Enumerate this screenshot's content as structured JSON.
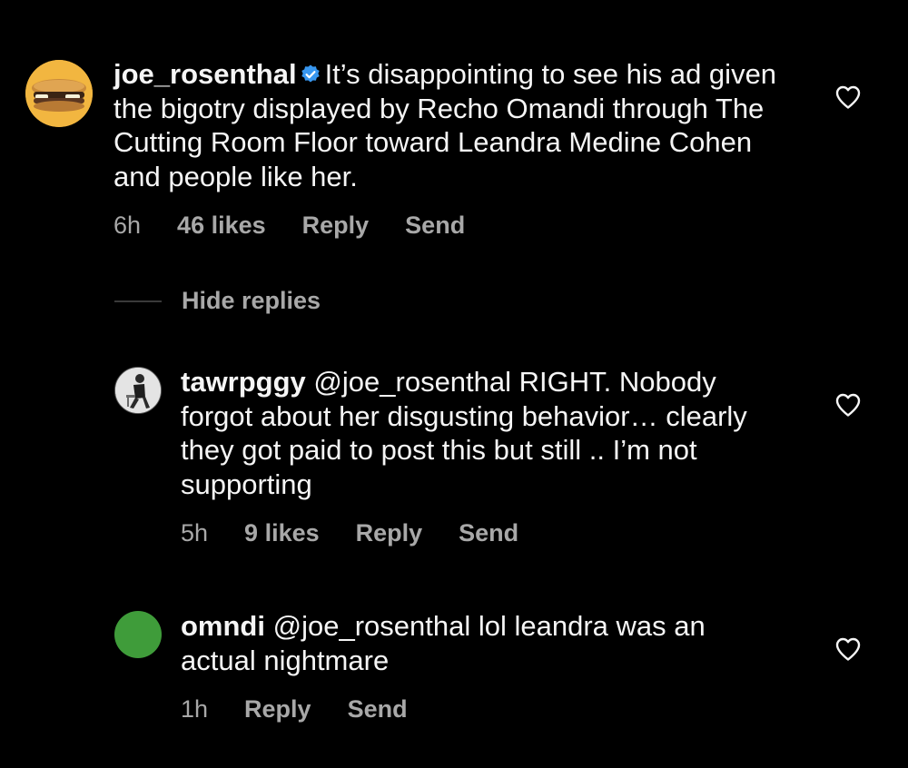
{
  "comments": [
    {
      "username": "joe_rosenthal",
      "verified": true,
      "text": "It’s disappointing to see his ad given the bigotry displayed by Recho Omandi through The Cutting Room Floor toward Leandra Medine Cohen and people like her.",
      "time": "6h",
      "likes": "46 likes",
      "reply_label": "Reply",
      "send_label": "Send",
      "avatar_icon": "sandwich-avatar"
    }
  ],
  "hide_replies_label": "Hide replies",
  "replies": [
    {
      "username": "tawrpggy",
      "mention": "@joe_rosenthal",
      "text": "RIGHT. Nobody forgot about her disgusting behavior… clearly they got paid to post this but still .. I’m not supporting",
      "time": "5h",
      "likes": "9 likes",
      "reply_label": "Reply",
      "send_label": "Send",
      "avatar_icon": "person-photo-avatar"
    },
    {
      "username": "omndi",
      "mention": "@joe_rosenthal",
      "text": "lol leandra was an actual nightmare",
      "time": "1h",
      "reply_label": "Reply",
      "send_label": "Send",
      "avatar_color": "#3f9c3a"
    }
  ],
  "icons": {
    "like": "heart-outline-icon",
    "verified": "verified-badge-icon"
  },
  "colors": {
    "background": "#000000",
    "text": "#f5f5f5",
    "muted": "#a8a8a8",
    "verified": "#3897f0"
  }
}
